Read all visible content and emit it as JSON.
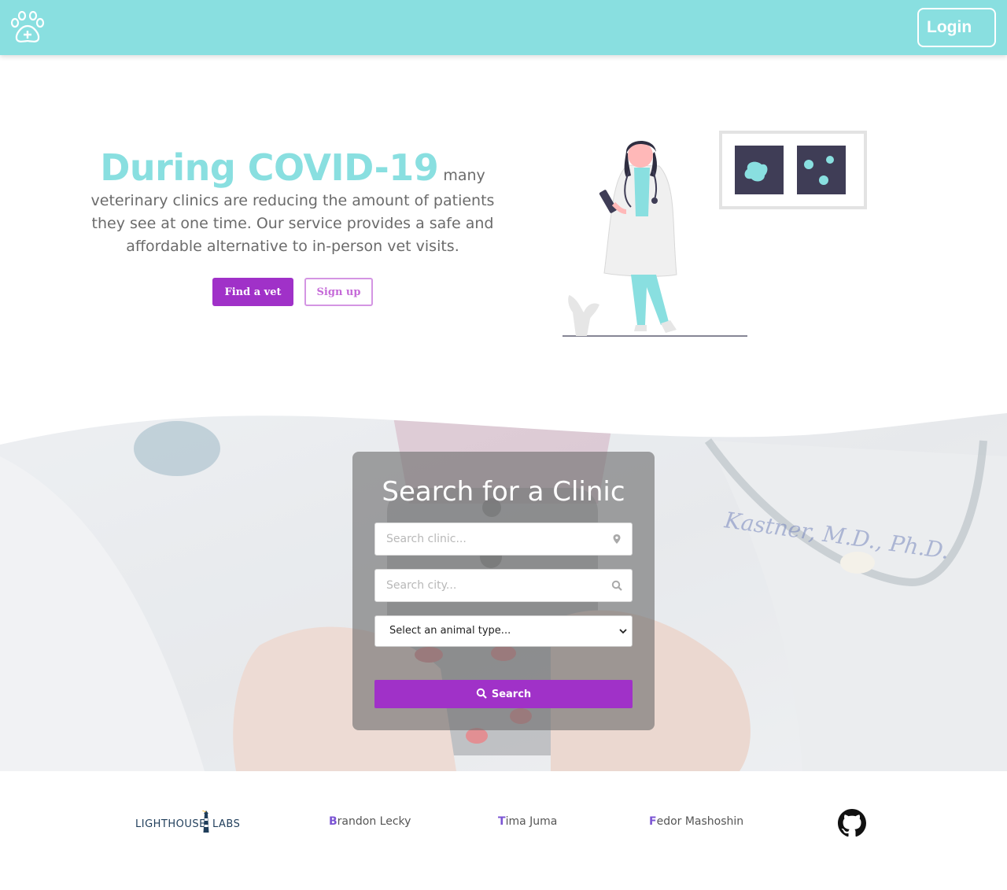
{
  "navbar": {
    "logo_icon": "paw-medical-cross-icon",
    "login_label": "Login",
    "color": "#89dfe0"
  },
  "hero": {
    "title": "During COVID-19",
    "body": "many veterinary clinics are reducing the amount of patients they see at one time. Our service provides a safe and affordable alternative to in-person vet visits.",
    "find_vet_label": "Find a vet",
    "signup_label": "Sign up",
    "illustration": "doctor-with-xray-illustration"
  },
  "search": {
    "title": "Search for a Clinic",
    "clinic_placeholder": "Search clinic...",
    "city_placeholder": "Search city...",
    "animal_select_value": "Select an animal type...",
    "search_label": "Search",
    "accent": "#a031c8"
  },
  "footer": {
    "logo_left": "LIGHTHOUSE",
    "logo_right": "LABS",
    "authors": [
      {
        "initial": "B",
        "rest": "randon Lecky"
      },
      {
        "initial": "T",
        "rest": "ima Juma"
      },
      {
        "initial": "F",
        "rest": "edor Mashoshin"
      }
    ],
    "github_icon": "github-icon"
  }
}
